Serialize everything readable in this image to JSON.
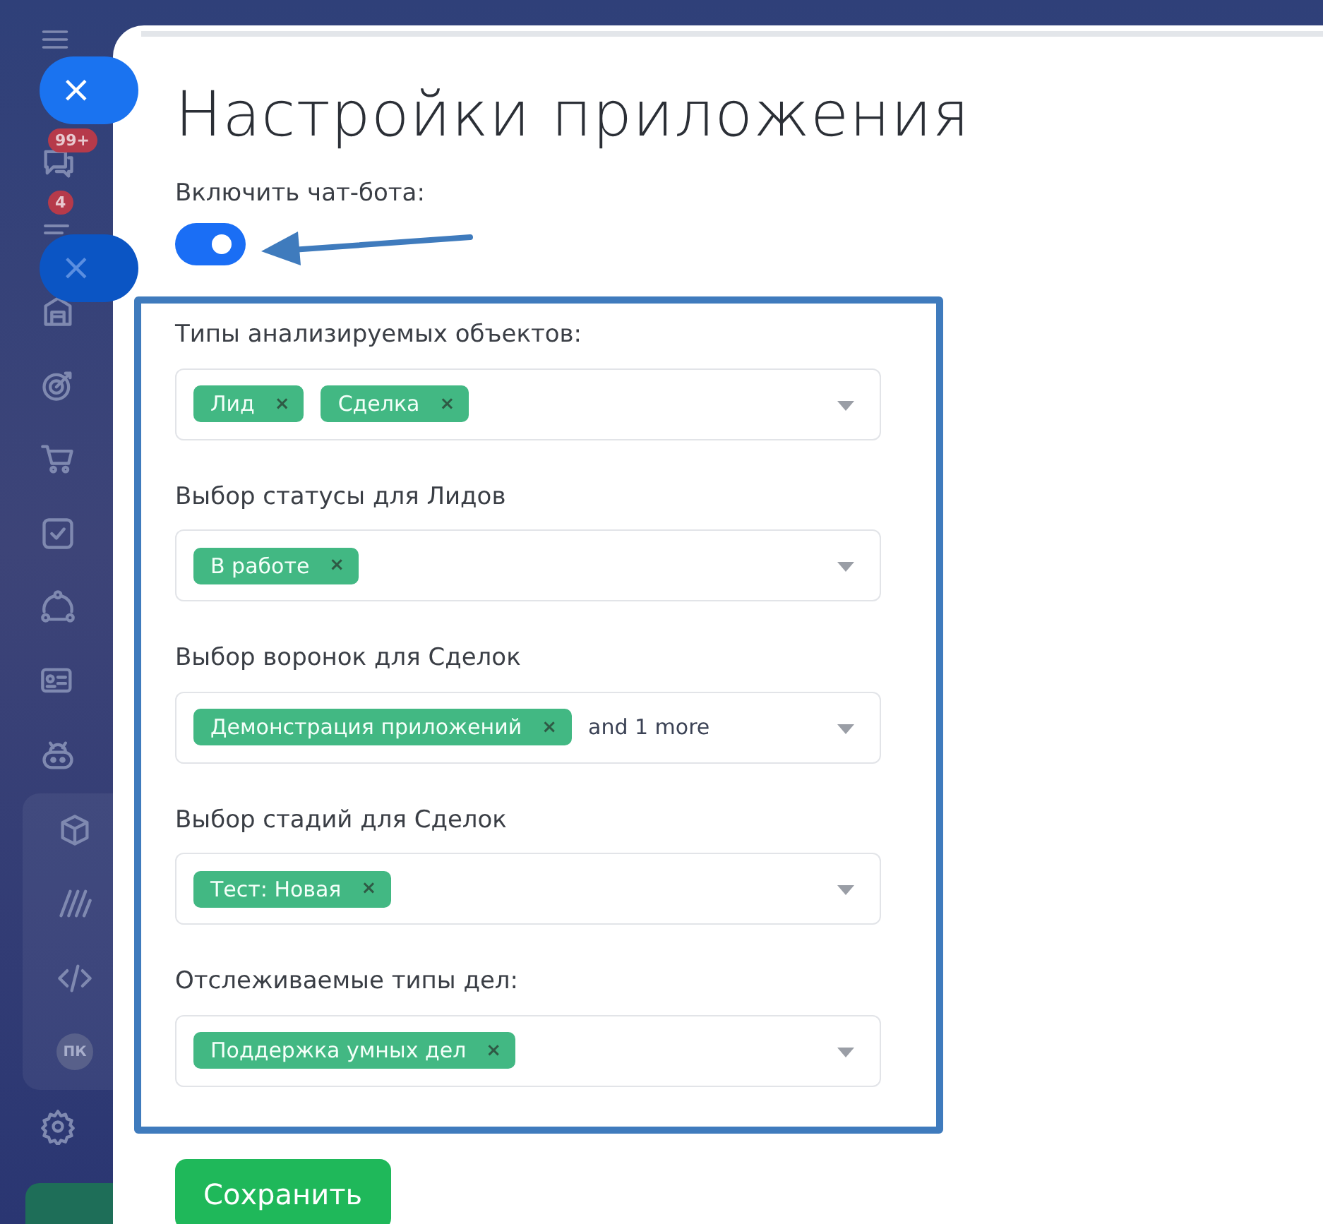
{
  "sidebar": {
    "items": [
      {
        "kind": "menu"
      },
      {
        "kind": "chat",
        "badge": "99+"
      },
      {
        "kind": "list",
        "badge": "4"
      },
      {
        "kind": "building"
      },
      {
        "kind": "target"
      },
      {
        "kind": "cart"
      },
      {
        "kind": "check"
      },
      {
        "kind": "flow"
      },
      {
        "kind": "card"
      },
      {
        "kind": "robot"
      },
      {
        "kind": "box",
        "grouped": true
      },
      {
        "kind": "stripes",
        "grouped": true
      },
      {
        "kind": "code",
        "grouped": true
      },
      {
        "kind": "avatar",
        "avatar": "ПК",
        "grouped": true
      },
      {
        "kind": "gear"
      }
    ]
  },
  "close_buttons": [
    {
      "label": "×",
      "dimmed": false
    },
    {
      "label": "×",
      "dimmed": true
    }
  ],
  "modal": {
    "title": "Настройки приложения",
    "chatbot": {
      "label": "Включить чат-бота:",
      "on": true
    },
    "fields": [
      {
        "label": "Типы анализируемых объектов:",
        "tags": [
          {
            "label": "Лид",
            "remove": "×"
          },
          {
            "label": "Сделка",
            "remove": "×"
          }
        ]
      },
      {
        "label": "Выбор статусы для Лидов",
        "tags": [
          {
            "label": "В работе",
            "remove": "×"
          }
        ]
      },
      {
        "label": "Выбор воронок для Сделок",
        "tags": [
          {
            "label": "Демонстрация приложений",
            "remove": "×"
          }
        ],
        "more": "and 1 more"
      },
      {
        "label": "Выбор стадий для Сделок",
        "tags": [
          {
            "label": "Тест: Новая",
            "remove": "×"
          }
        ]
      },
      {
        "label": "Отслеживаемые типы дел:",
        "tags": [
          {
            "label": "Поддержка умных дел",
            "remove": "×"
          }
        ]
      }
    ],
    "save_button": "Сохранить"
  }
}
